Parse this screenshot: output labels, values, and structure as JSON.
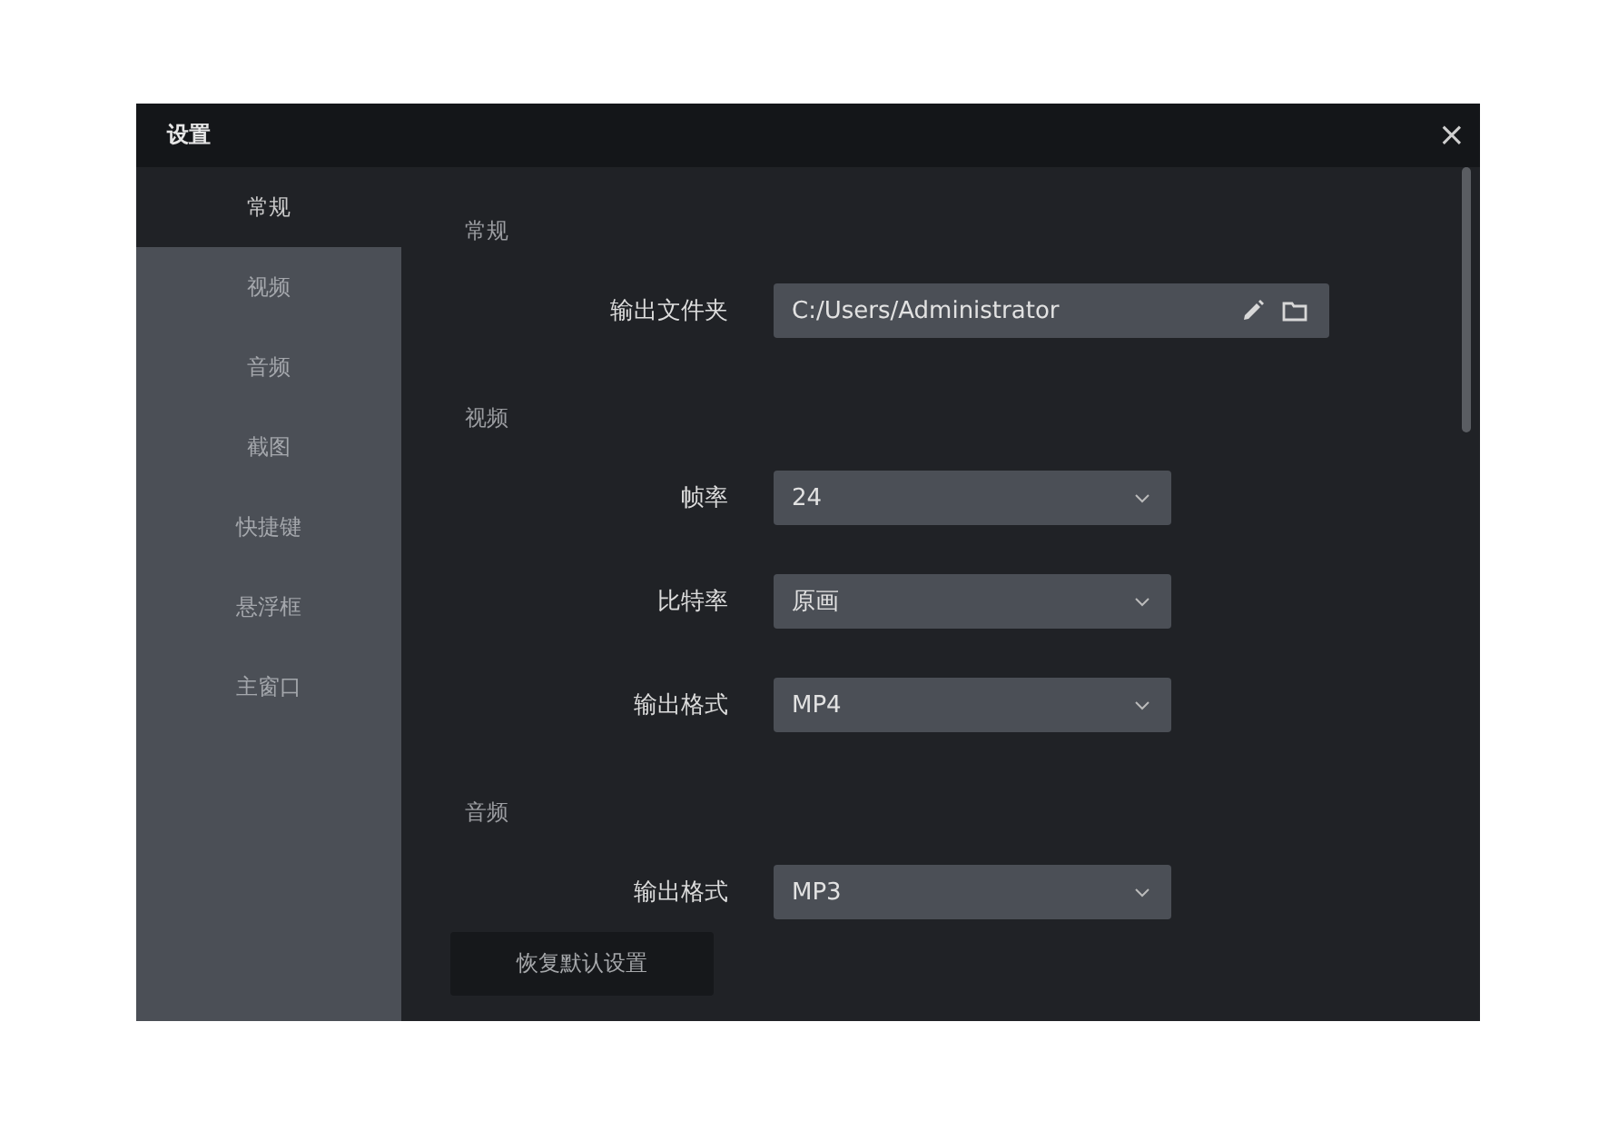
{
  "window": {
    "title": "设置",
    "close": "×"
  },
  "sidebar": {
    "items": [
      {
        "label": "常规",
        "selected": true
      },
      {
        "label": "视频",
        "selected": false
      },
      {
        "label": "音频",
        "selected": false
      },
      {
        "label": "截图",
        "selected": false
      },
      {
        "label": "快捷键",
        "selected": false
      },
      {
        "label": "悬浮框",
        "selected": false
      },
      {
        "label": "主窗口",
        "selected": false
      }
    ]
  },
  "sections": [
    {
      "title": "常规",
      "fields": [
        {
          "kind": "path",
          "label": "输出文件夹",
          "value": "C:/Users/Administrator"
        }
      ]
    },
    {
      "title": "视频",
      "fields": [
        {
          "kind": "select",
          "label": "帧率",
          "value": "24"
        },
        {
          "kind": "select",
          "label": "比特率",
          "value": "原画"
        },
        {
          "kind": "select",
          "label": "输出格式",
          "value": "MP4"
        }
      ]
    },
    {
      "title": "音频",
      "fields": [
        {
          "kind": "select",
          "label": "输出格式",
          "value": "MP3"
        }
      ]
    }
  ],
  "reset_button": "恢复默认设置"
}
